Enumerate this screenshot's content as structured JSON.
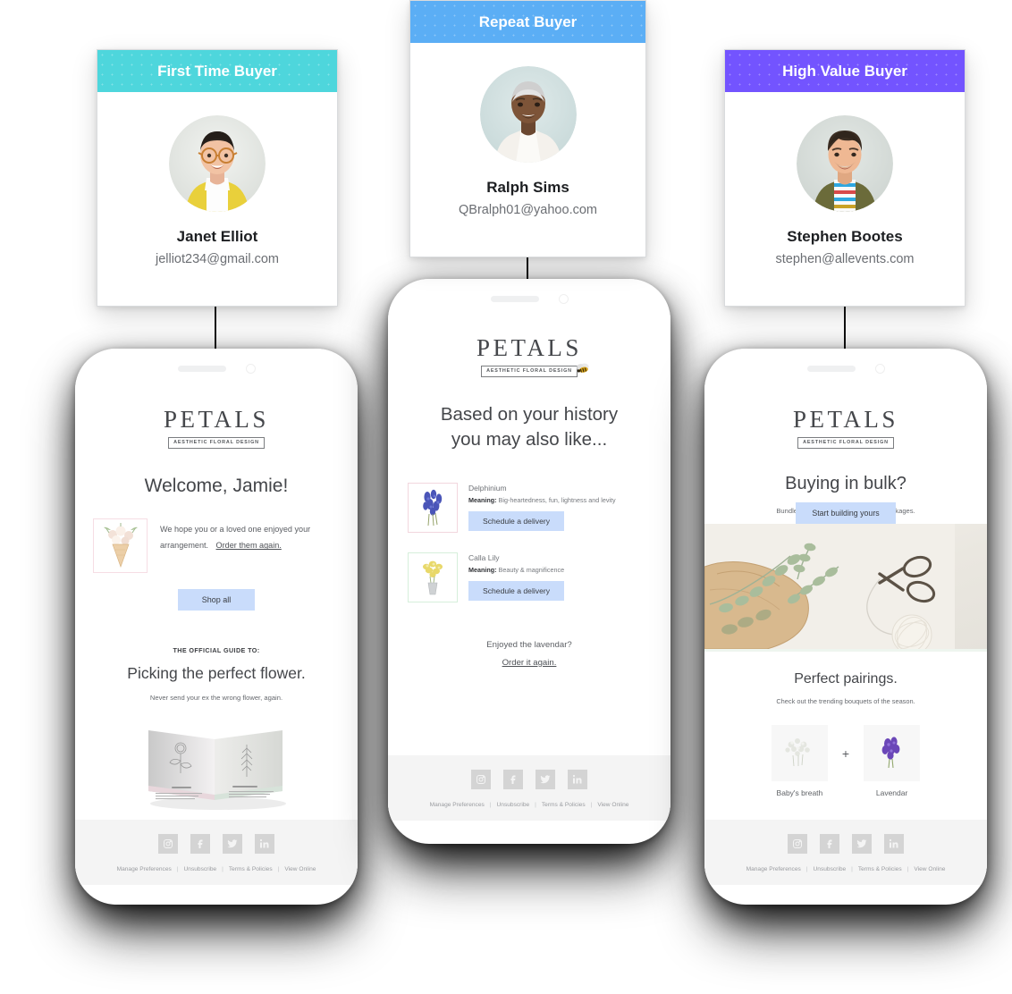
{
  "cards": [
    {
      "badge": "First Time Buyer",
      "badge_color": "#4ED6DC",
      "name": "Janet Elliot",
      "email": "jelliot234@gmail.com",
      "avatar_name": "avatar-janet-elliot"
    },
    {
      "badge": "Repeat Buyer",
      "badge_color": "#5BAEF5",
      "name": "Ralph Sims",
      "email": "QBralph01@yahoo.com",
      "avatar_name": "avatar-ralph-sims"
    },
    {
      "badge": "High Value Buyer",
      "badge_color": "#7354FF",
      "name": "Stephen Bootes",
      "email": "stephen@allevents.com",
      "avatar_name": "avatar-stephen-bootes"
    }
  ],
  "brand": {
    "word": "PETALS",
    "tagline": "AESTHETIC FLORAL DESIGN"
  },
  "footer": {
    "socials": [
      "instagram-icon",
      "facebook-icon",
      "twitter-icon",
      "linkedin-icon"
    ],
    "links": [
      "Manage Preferences",
      "Unsubscribe",
      "Terms & Policies",
      "View Online"
    ],
    "separator": "|"
  },
  "email_one": {
    "heading": "Welcome, Jamie!",
    "body_text": "We hope you or a loved one enjoyed your arrangement.",
    "body_link": "Order them again.",
    "cta": "Shop all",
    "eyebrow": "THE OFFICIAL GUIDE TO:",
    "guide_title": "Picking the perfect flower.",
    "guide_sub": "Never send your ex the wrong flower, again.",
    "hero_image": "bouquet-cone-illustration",
    "guide_image": "open-book-flower-guide"
  },
  "email_two": {
    "heading_line1": "Based on your history",
    "heading_line2": "you may also like...",
    "bee_icon": "bee-icon",
    "products": [
      {
        "name": "Delphinium",
        "meaning_label": "Meaning:",
        "meaning": "Big-heartedness, fun, lightness and levity",
        "cta": "Schedule a delivery",
        "thumb": "delphinium-thumb"
      },
      {
        "name": "Calla Lily",
        "meaning_label": "Meaning:",
        "meaning": "Beauty & magnificence",
        "cta": "Schedule a delivery",
        "thumb": "calla-lily-thumb"
      }
    ],
    "reorder_question": "Enjoyed the lavendar?",
    "reorder_link": "Order it again."
  },
  "email_three": {
    "heading": "Buying in bulk?",
    "sub": "Bundle and save with customizable packages.",
    "cta": "Start building yours",
    "hero_image": "eucalyptus-wrapping-paper-scissors",
    "pairings_title": "Perfect pairings.",
    "pairings_sub": "Check out the trending bouquets of the season.",
    "pairings": [
      {
        "label": "Baby's breath",
        "thumb": "babys-breath-thumb"
      },
      {
        "label": "Lavendar",
        "thumb": "lavendar-thumb"
      }
    ],
    "plus": "+"
  }
}
